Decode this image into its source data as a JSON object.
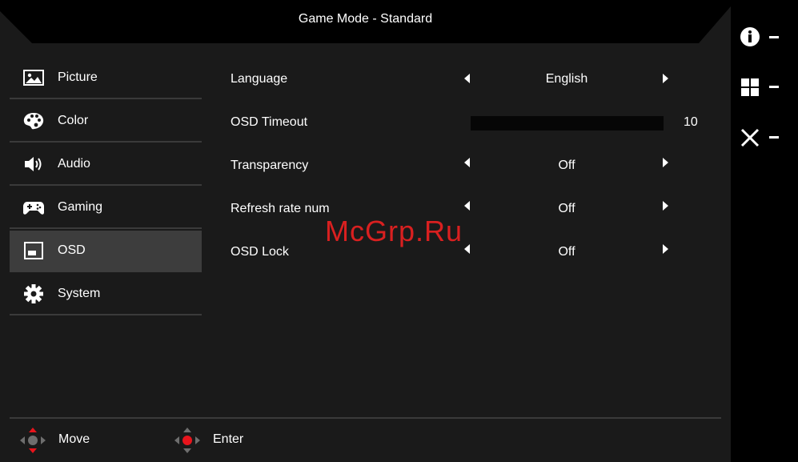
{
  "header": {
    "title": "Game Mode - Standard"
  },
  "menu": {
    "items": [
      {
        "label": "Picture",
        "icon": "picture-icon"
      },
      {
        "label": "Color",
        "icon": "palette-icon"
      },
      {
        "label": "Audio",
        "icon": "speaker-icon"
      },
      {
        "label": "Gaming",
        "icon": "gamepad-icon"
      },
      {
        "label": "OSD",
        "icon": "osd-icon",
        "active": true
      },
      {
        "label": "System",
        "icon": "gear-icon"
      }
    ]
  },
  "settings": {
    "language": {
      "label": "Language",
      "value": "English"
    },
    "osd_timeout": {
      "label": "OSD Timeout",
      "value": "10"
    },
    "transparency": {
      "label": "Transparency",
      "value": "Off"
    },
    "refresh_rate_num": {
      "label": "Refresh rate num",
      "value": "Off"
    },
    "osd_lock": {
      "label": "OSD Lock",
      "value": "Off"
    }
  },
  "footer": {
    "move_label": "Move",
    "enter_label": "Enter"
  },
  "side_buttons": [
    {
      "icon": "info-icon",
      "value": "-"
    },
    {
      "icon": "grid-icon",
      "value": "-"
    },
    {
      "icon": "close-icon",
      "value": "-"
    }
  ],
  "watermark": "McGrp.Ru",
  "colors": {
    "background": "#1a1a1a",
    "selected": "#3d3d3d",
    "accent": "#e8141c"
  }
}
